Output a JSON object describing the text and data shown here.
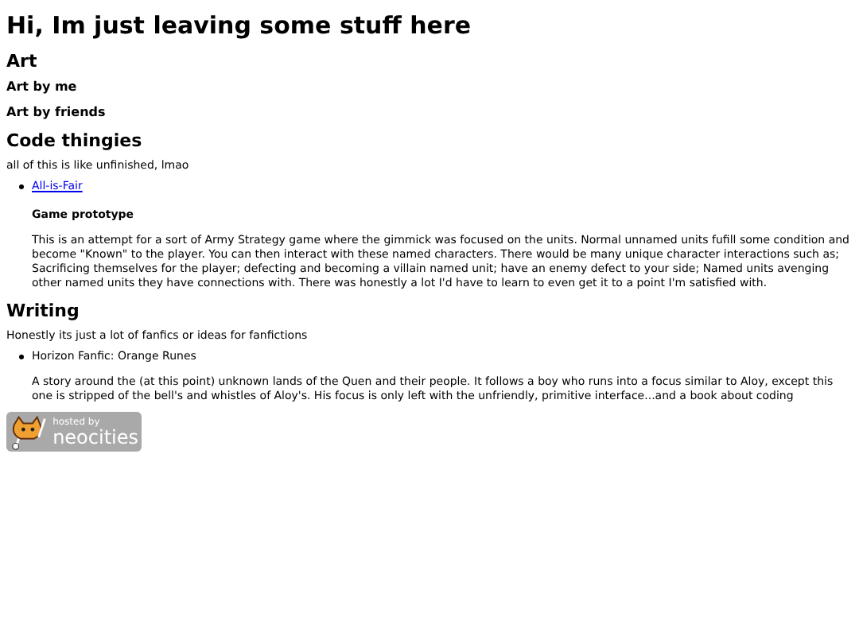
{
  "title": "Hi, Im just leaving some stuff here",
  "sections": [
    {
      "heading": "Art",
      "subheadings": [
        "Art by me",
        "Art by friends"
      ]
    },
    {
      "heading": "Code thingies",
      "intro": "all of this is like unfinished, lmao",
      "items": [
        {
          "kind": "link",
          "label": "All-is-Fair",
          "subtitle": "Game prototype",
          "description": "This is an attempt for a sort of Army Strategy game where the gimmick was focused on the units. Normal unnamed units fufill some condition and become \"Known\" to the player. You can then interact with these named characters. There would be many unique character interactions such as; Sacrificing themselves for the player; defecting and becoming a villain named unit; have an enemy defect to your side; Named units avenging other named units they have connections with. There was honestly a lot I'd have to learn to even get it to a point I'm satisfied with."
        }
      ]
    },
    {
      "heading": "Writing",
      "intro": "Honestly its just a lot of fanfics or ideas for fanfictions",
      "items": [
        {
          "kind": "text",
          "label": "Horizon Fanfic: Orange Runes",
          "description": "A story around the (at this point) unknown lands of the Quen and their people. It follows a boy who runs into a focus similar to Aloy, except this one is stripped of the bell's and whistles of Aloy's. His focus is only left with the unfriendly, primitive interface...and a book about coding"
        }
      ]
    }
  ],
  "badge": {
    "top": "hosted by",
    "bottom": "neocities"
  }
}
